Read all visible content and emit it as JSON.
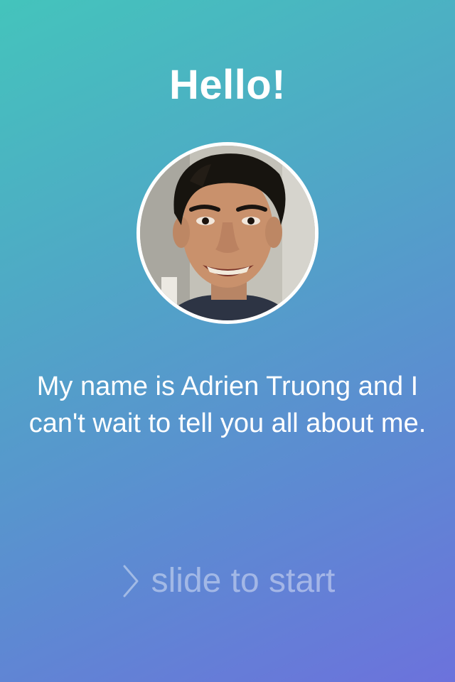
{
  "screen": {
    "greeting": "Hello!",
    "intro": "My name is Adrien Truong and I can't wait to tell you all about me.",
    "slide_label": "slide to start"
  },
  "icons": {
    "slide_icon": "chevron-right-icon"
  },
  "colors": {
    "gradient_start": "#44c4bc",
    "gradient_end": "#6c72dc",
    "text": "#ffffff"
  }
}
